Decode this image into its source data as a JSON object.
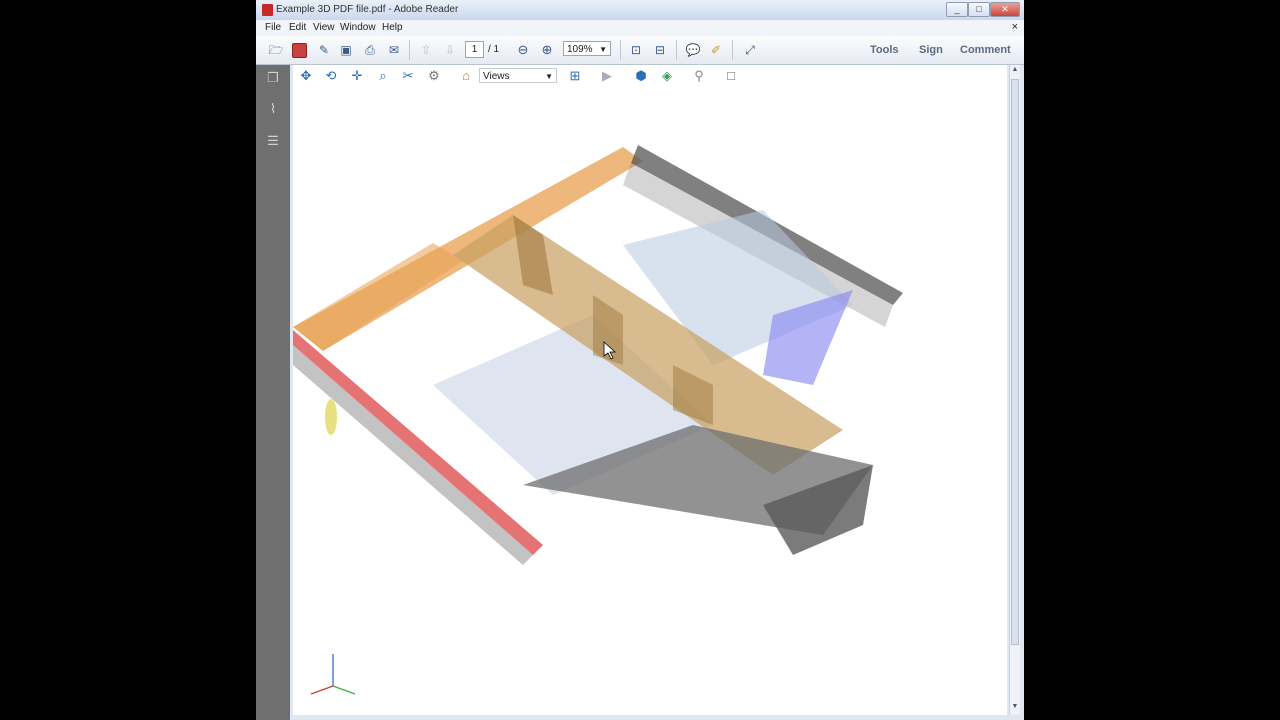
{
  "window": {
    "title": "Example 3D PDF file.pdf - Adobe Reader",
    "controls": [
      "_",
      "□",
      "✕"
    ]
  },
  "menu": {
    "items": [
      "File",
      "Edit",
      "View",
      "Window",
      "Help"
    ],
    "close": "×"
  },
  "toolbar": {
    "page_current": "1",
    "page_total": "/ 1",
    "zoom": "109%",
    "tools_label": "Tools",
    "sign_label": "Sign",
    "comment_label": "Comment"
  },
  "toolbar3d": {
    "views_label": "Views"
  },
  "colors": {
    "accent": "#2a6fb8",
    "model_orange": "#e8a050",
    "model_red": "#e05050",
    "model_blue": "#8a8af0",
    "model_gray": "#6e6e6e"
  },
  "icons": [
    "open-icon",
    "create-pdf-icon",
    "edit-icon",
    "save-icon",
    "print-icon",
    "email-icon",
    "prev-page-icon",
    "next-page-icon",
    "zoom-out-icon",
    "zoom-in-icon",
    "fit-page-icon",
    "fit-width-icon",
    "comment-bubble-icon",
    "highlight-icon",
    "fullscreen-icon",
    "rotate-3d-icon",
    "spin-3d-icon",
    "pan-3d-icon",
    "zoom-3d-icon",
    "walk-3d-icon",
    "fly-3d-icon",
    "home-view-icon",
    "model-tree-icon",
    "play-icon",
    "render-mode-icon",
    "lighting-icon",
    "background-icon",
    "cross-section-icon"
  ]
}
